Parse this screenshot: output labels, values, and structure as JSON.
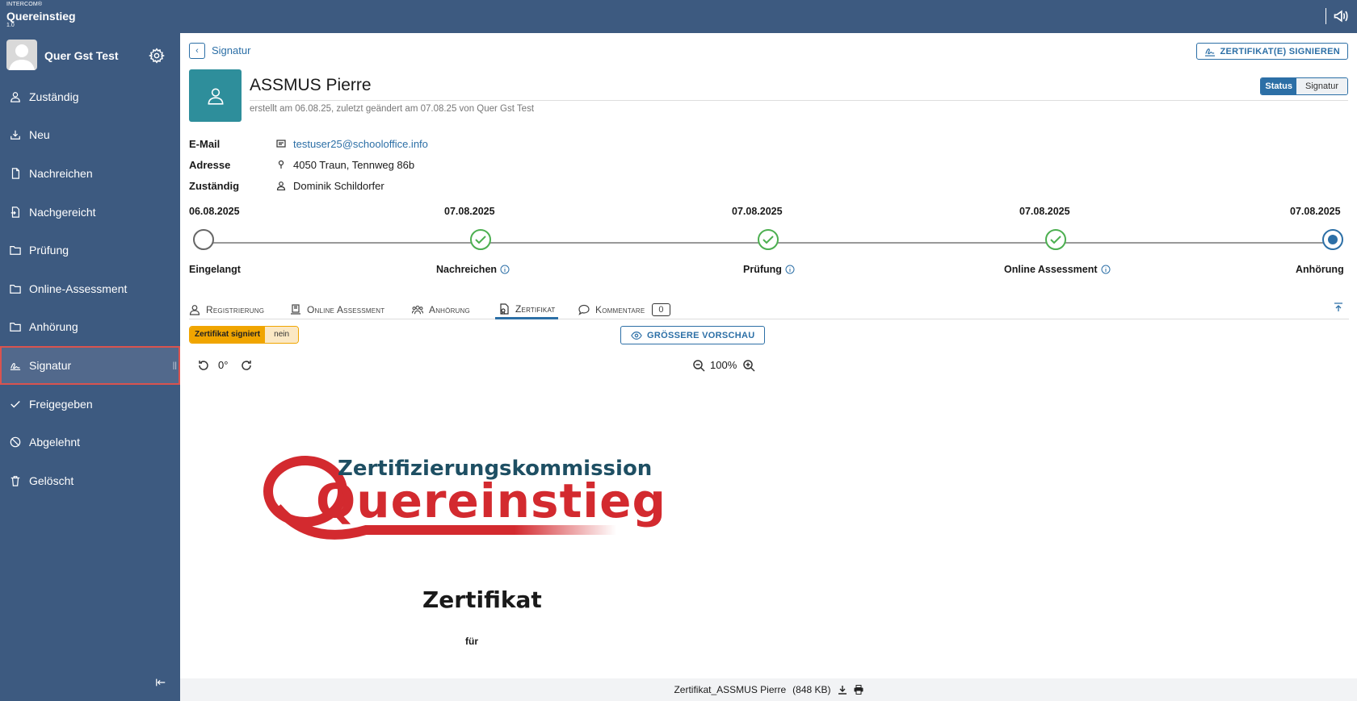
{
  "app": {
    "vendor": "INTERCOM®",
    "title": "Quereinstieg",
    "version": "1.0"
  },
  "user": {
    "name": "Quer Gst Test"
  },
  "nav": {
    "items": [
      {
        "label": "Zuständig",
        "icon": "person-icon"
      },
      {
        "label": "Neu",
        "icon": "inbox-icon"
      },
      {
        "label": "Nachreichen",
        "icon": "document-icon"
      },
      {
        "label": "Nachgereicht",
        "icon": "document-in-icon"
      },
      {
        "label": "Prüfung",
        "icon": "folder-icon"
      },
      {
        "label": "Online-Assessment",
        "icon": "folder-icon"
      },
      {
        "label": "Anhörung",
        "icon": "folder-icon"
      },
      {
        "label": "Signatur",
        "icon": "signature-icon",
        "active": true
      },
      {
        "label": "Freigegeben",
        "icon": "check-icon"
      },
      {
        "label": "Abgelehnt",
        "icon": "block-icon"
      },
      {
        "label": "Gelöscht",
        "icon": "trash-icon"
      }
    ]
  },
  "header": {
    "back_label": "Signatur",
    "sign_button": "ZERTIFIKAT(E) SIGNIEREN"
  },
  "person": {
    "name": "ASSMUS Pierre",
    "meta": "erstellt am 06.08.25, zuletzt geändert am 07.08.25 von Quer Gst Test",
    "status_toggle": {
      "left": "Status",
      "right": "Signatur"
    }
  },
  "details": {
    "email_label": "E-Mail",
    "email": "testuser25@schooloffice.info",
    "address_label": "Adresse",
    "address": "4050 Traun, Tennweg 86b",
    "owner_label": "Zuständig",
    "owner": "Dominik Schildorfer"
  },
  "timeline": {
    "steps": [
      {
        "date": "06.08.2025",
        "label": "Eingelangt",
        "state": "open"
      },
      {
        "date": "07.08.2025",
        "label": "Nachreichen",
        "state": "done"
      },
      {
        "date": "07.08.2025",
        "label": "Prüfung",
        "state": "done"
      },
      {
        "date": "07.08.2025",
        "label": "Online Assessment",
        "state": "done"
      },
      {
        "date": "07.08.2025",
        "label": "Anhörung",
        "state": "current"
      }
    ]
  },
  "tabs": {
    "registrierung": "Registrierung",
    "online_assessment": "Online Assessment",
    "anhoerung": "Anhörung",
    "zertifikat": "Zertifikat",
    "kommentare": "Kommentare",
    "kommentare_count": "0"
  },
  "certificate": {
    "signed_label": "Zertifikat signiert",
    "signed_value": "nein",
    "preview_button": "GRÖSSERE VORSCHAU",
    "rotation": "0°",
    "zoom": "100%",
    "logo_top": "Zertifizierungskommission",
    "logo_bottom": "Quereinstieg",
    "title": "Zertifikat",
    "for": "für",
    "file_name": "Zertifikat_ASSMUS Pierre",
    "file_size": "(848 KB)"
  },
  "colors": {
    "sidebar": "#3d5a80",
    "accent": "#2c6fa6",
    "tile": "#2e8e9b",
    "done": "#4caf50",
    "logo_red": "#d32a2f",
    "logo_teal": "#1e4f63"
  }
}
